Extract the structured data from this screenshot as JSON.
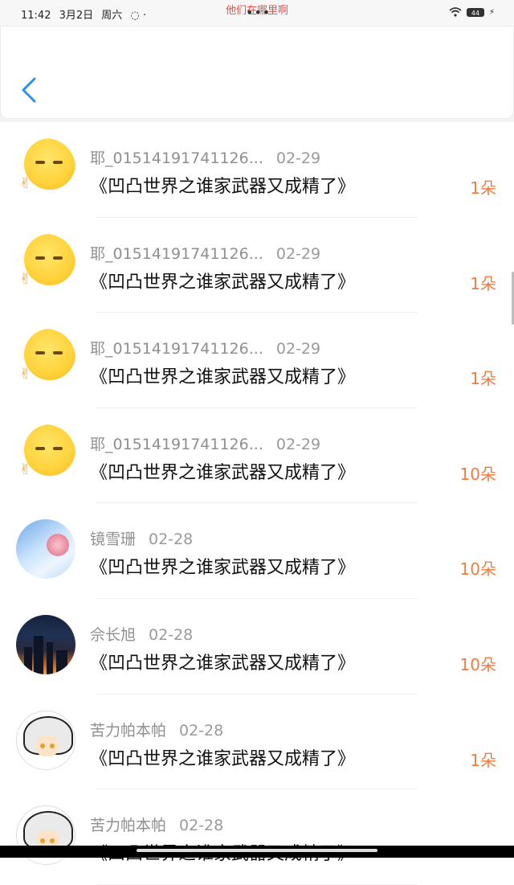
{
  "status_bar": {
    "time": "11:42",
    "date": "3月2日",
    "weekday": "周六",
    "center_text": "他们在哪里啊",
    "battery": "44"
  },
  "colors": {
    "accent": "#2a8ff0",
    "count": "#f07c3e",
    "overlay_text": "#e0534f"
  },
  "items": [
    {
      "user": "耶_01514191741126...",
      "date": "02-29",
      "book": "《凹凸世界之谁家武器又成精了》",
      "count": "1朵",
      "avatar": "emoji-avatar"
    },
    {
      "user": "耶_01514191741126...",
      "date": "02-29",
      "book": "《凹凸世界之谁家武器又成精了》",
      "count": "1朵",
      "avatar": "emoji-avatar"
    },
    {
      "user": "耶_01514191741126...",
      "date": "02-29",
      "book": "《凹凸世界之谁家武器又成精了》",
      "count": "1朵",
      "avatar": "emoji-avatar"
    },
    {
      "user": "耶_01514191741126...",
      "date": "02-29",
      "book": "《凹凸世界之谁家武器又成精了》",
      "count": "10朵",
      "avatar": "emoji-avatar"
    },
    {
      "user": "镜雪珊",
      "date": "02-28",
      "book": "《凹凸世界之谁家武器又成精了》",
      "count": "10朵",
      "avatar": "sky-avatar"
    },
    {
      "user": "佘长旭",
      "date": "02-28",
      "book": "《凹凸世界之谁家武器又成精了》",
      "count": "10朵",
      "avatar": "city-avatar"
    },
    {
      "user": "苦力帕本帕",
      "date": "02-28",
      "book": "《凹凸世界之谁家武器又成精了》",
      "count": "1朵",
      "avatar": "anime-avatar"
    },
    {
      "user": "苦力帕本帕",
      "date": "02-28",
      "book": "《凹凸世界之谁家武器又成精了》",
      "count": "",
      "avatar": "anime-avatar"
    }
  ]
}
